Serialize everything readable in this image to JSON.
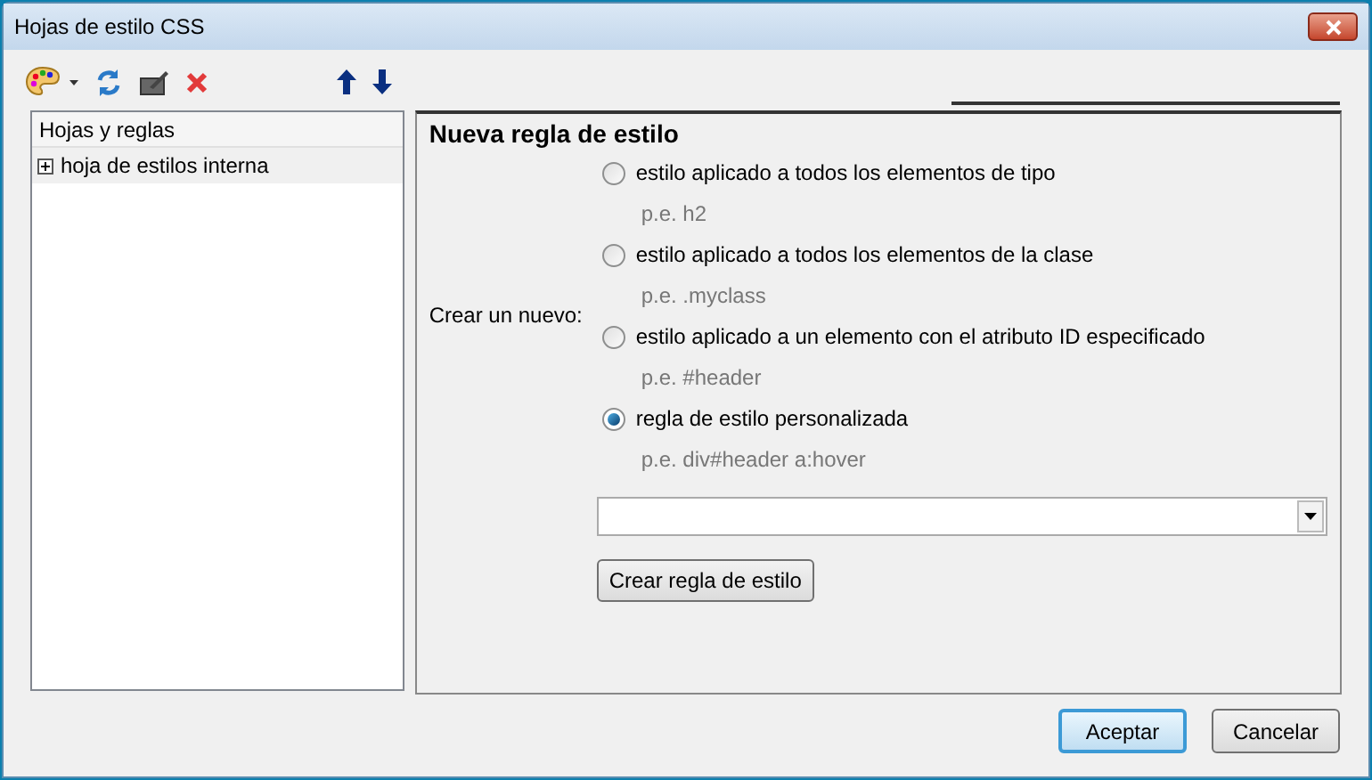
{
  "window": {
    "title": "Hojas de estilo CSS"
  },
  "sidebar": {
    "header": "Hojas y reglas",
    "items": [
      {
        "label": "hoja de estilos interna",
        "expanded": false
      }
    ]
  },
  "panel": {
    "title": "Nueva regla de estilo",
    "create_label": "Crear un nuevo:",
    "options": [
      {
        "label": "estilo aplicado a todos los elementos de tipo",
        "example": "p.e. h2",
        "selected": false
      },
      {
        "label": "estilo aplicado a todos los elementos de la clase",
        "example": "p.e. .myclass",
        "selected": false
      },
      {
        "label": "estilo aplicado a un elemento con el atributo ID especificado",
        "example": "p.e. #header",
        "selected": false
      },
      {
        "label": "regla de estilo personalizada",
        "example": "p.e. div#header a:hover",
        "selected": true
      }
    ],
    "create_button": "Crear regla de estilo"
  },
  "buttons": [
    {
      "label": "Aceptar",
      "default": true
    },
    {
      "label": "Cancelar",
      "default": false
    }
  ]
}
